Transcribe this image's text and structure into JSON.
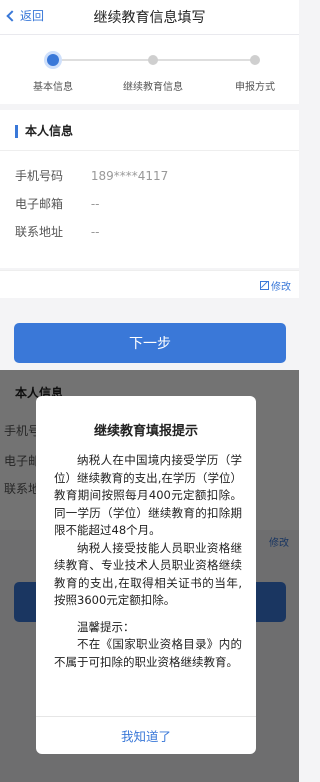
{
  "nav": {
    "back_label": "返回",
    "title": "继续教育信息填写"
  },
  "stepper": {
    "steps": [
      {
        "label": "基本信息",
        "active": true
      },
      {
        "label": "继续教育信息",
        "active": false
      },
      {
        "label": "申报方式",
        "active": false
      }
    ]
  },
  "personal": {
    "section_title": "本人信息",
    "fields": [
      {
        "label": "手机号码",
        "value": "189****4117"
      },
      {
        "label": "电子邮箱",
        "value": "--"
      },
      {
        "label": "联系地址",
        "value": "--"
      }
    ],
    "edit_label": "修改"
  },
  "next_button": "下一步",
  "modal": {
    "title": "继续教育填报提示",
    "para1": "纳税人在中国境内接受学历（学位）继续教育的支出,在学历（学位）教育期间按照每月400元定额扣除。同一学历（学位）继续教育的扣除期限不能超过48个月。",
    "para2": "纳税人接受技能人员职业资格继续教育、专业技术人员职业资格继续教育的支出,在取得相关证书的当年,按照3600元定额扣除。",
    "tip_heading": "温馨提示：",
    "tip_text": "不在《国家职业资格目录》内的不属于可扣除的职业资格继续教育。",
    "confirm_label": "我知道了"
  },
  "colors": {
    "accent": "#3a78d8"
  }
}
